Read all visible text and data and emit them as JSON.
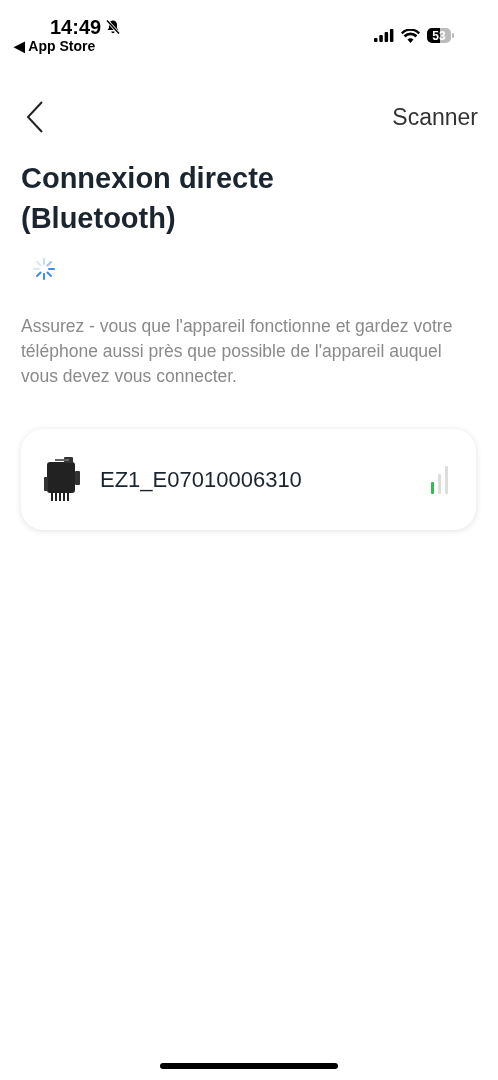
{
  "status_bar": {
    "time": "14:49",
    "back_app": "◀ App Store",
    "battery": "53"
  },
  "nav": {
    "action": "Scanner"
  },
  "title": "Connexion directe (Bluetooth)",
  "description": "Assurez - vous que l'appareil fonctionne et gardez votre téléphone aussi près que possible de l'appareil auquel vous devez vous connecter.",
  "devices": [
    {
      "name": "EZ1_E07010006310"
    }
  ]
}
